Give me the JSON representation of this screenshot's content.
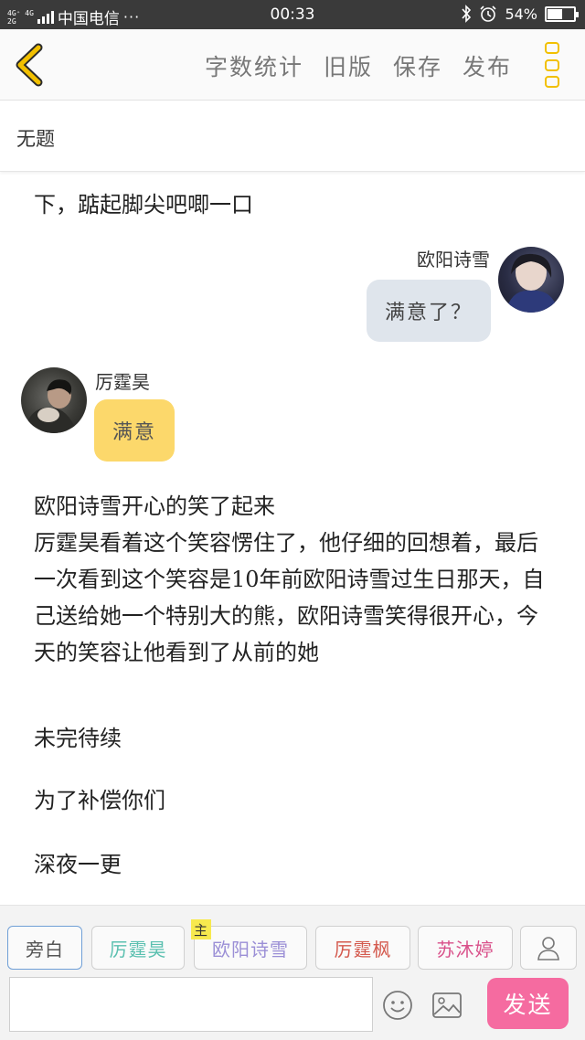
{
  "status_bar": {
    "network": "4G⁺ 4G\n2G",
    "carrier": "中国电信",
    "more": "···",
    "time": "00:33",
    "battery": "54%",
    "battery_level": 0.54,
    "icons": [
      "bluetooth-icon",
      "alarm-icon",
      "battery-icon"
    ]
  },
  "toolbar": {
    "back_icon": "chevron-left-icon",
    "actions": [
      "字数统计",
      "旧版",
      "保存",
      "发布"
    ],
    "menu_icon": "more-vertical-icon",
    "accent": "#f2c000"
  },
  "title": "无题",
  "story": {
    "narration_top": "下，踮起脚尖吧唧一口",
    "messages": [
      {
        "side": "right",
        "name": "欧阳诗雪",
        "text": "满意了？",
        "bubble_color": "#dfe5ec"
      },
      {
        "side": "left",
        "name": "厉霆昊",
        "text": "满意",
        "bubble_color": "#fcd86b"
      }
    ],
    "narration_main": "欧阳诗雪开心的笑了起来\n厉霆昊看着这个笑容愣住了，他仔细的回想着，最后一次看到这个笑容是10年前欧阳诗雪过生日那天，自己送给她一个特别大的熊，欧阳诗雪笑得很开心，今天的笑容让他看到了从前的她",
    "to_be_continued": "未完待续",
    "compensation": "为了补偿你们",
    "late_night": "深夜一更"
  },
  "roles": {
    "items": [
      "旁白",
      "厉霆昊",
      "欧阳诗雪",
      "厉霆枫",
      "苏沐婷"
    ],
    "main_badge": "主",
    "add_role_icon": "person-icon"
  },
  "composer": {
    "input_value": "",
    "emoji_icon": "smiley-icon",
    "image_icon": "image-icon",
    "send_label": "发送",
    "send_color": "#f56ba0"
  }
}
